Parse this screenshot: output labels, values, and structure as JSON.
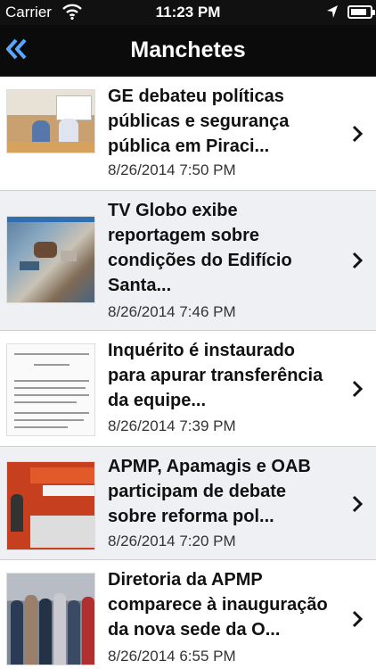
{
  "status_bar": {
    "carrier": "Carrier",
    "time": "11:23 PM",
    "battery_level": 0.85
  },
  "nav": {
    "title": "Manchetes",
    "back_icon": "double-chevron-left-icon"
  },
  "accent": "#5aa7ff",
  "items": [
    {
      "headline": "GE debateu políticas públicas e segurança pública em Piraci...",
      "date": "8/26/2014 7:50 PM"
    },
    {
      "headline": "TV Globo exibe reportagem sobre condições do Edifício Santa...",
      "date": "8/26/2014 7:46 PM"
    },
    {
      "headline": "Inquérito é instaurado para apurar transferência da equipe...",
      "date": "8/26/2014 7:39 PM"
    },
    {
      "headline": "APMP, Apamagis e OAB participam de debate sobre reforma pol...",
      "date": "8/26/2014 7:20 PM"
    },
    {
      "headline": "Diretoria da APMP comparece à inauguração da nova sede da O...",
      "date": "8/26/2014 6:55 PM"
    }
  ]
}
